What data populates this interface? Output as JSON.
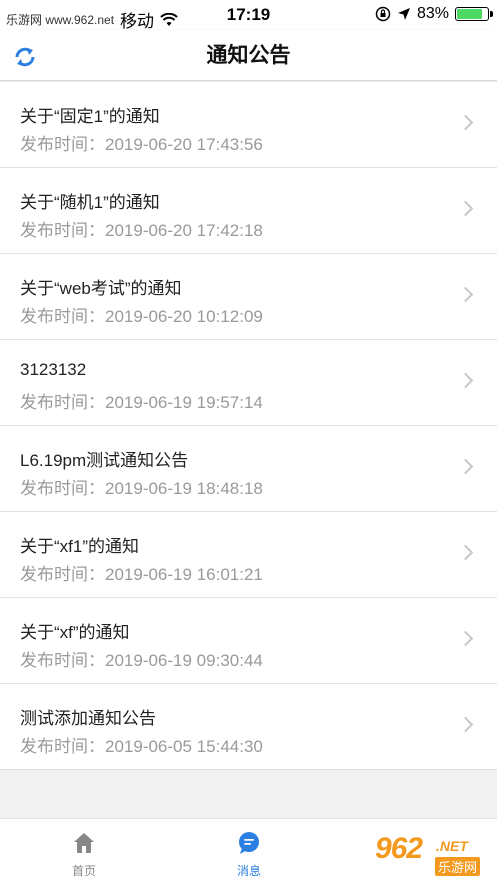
{
  "status_bar": {
    "watermark": "乐游网 www.962.net",
    "carrier": "移动",
    "time": "17:19",
    "battery": "83%",
    "battery_level": 0.83
  },
  "header": {
    "title": "通知公告"
  },
  "notices": [
    {
      "title": "关于“固定1”的通知",
      "date": "发布时间：2019-06-20 17:43:56"
    },
    {
      "title": "关于“随机1”的通知",
      "date": "发布时间：2019-06-20 17:42:18"
    },
    {
      "title": "关于“web考试”的通知",
      "date": "发布时间：2019-06-20 10:12:09"
    },
    {
      "title": "3123132",
      "date": "发布时间：2019-06-19 19:57:14"
    },
    {
      "title": "L6.19pm测试通知公告",
      "date": "发布时间：2019-06-19 18:48:18"
    },
    {
      "title": "关于“xf1”的通知",
      "date": "发布时间：2019-06-19 16:01:21"
    },
    {
      "title": "关于“xf”的通知",
      "date": "发布时间：2019-06-19 09:30:44"
    },
    {
      "title": "测试添加通知公告",
      "date": "发布时间：2019-06-05 15:44:30"
    }
  ],
  "tabs": {
    "home": "首页",
    "messages": "消息"
  },
  "brand": {
    "logo": "962",
    "net": ".NET",
    "name": "乐游网"
  },
  "colors": {
    "accent": "#2a7fe0",
    "battery": "#4cd964",
    "brand": "#f39a1e"
  }
}
